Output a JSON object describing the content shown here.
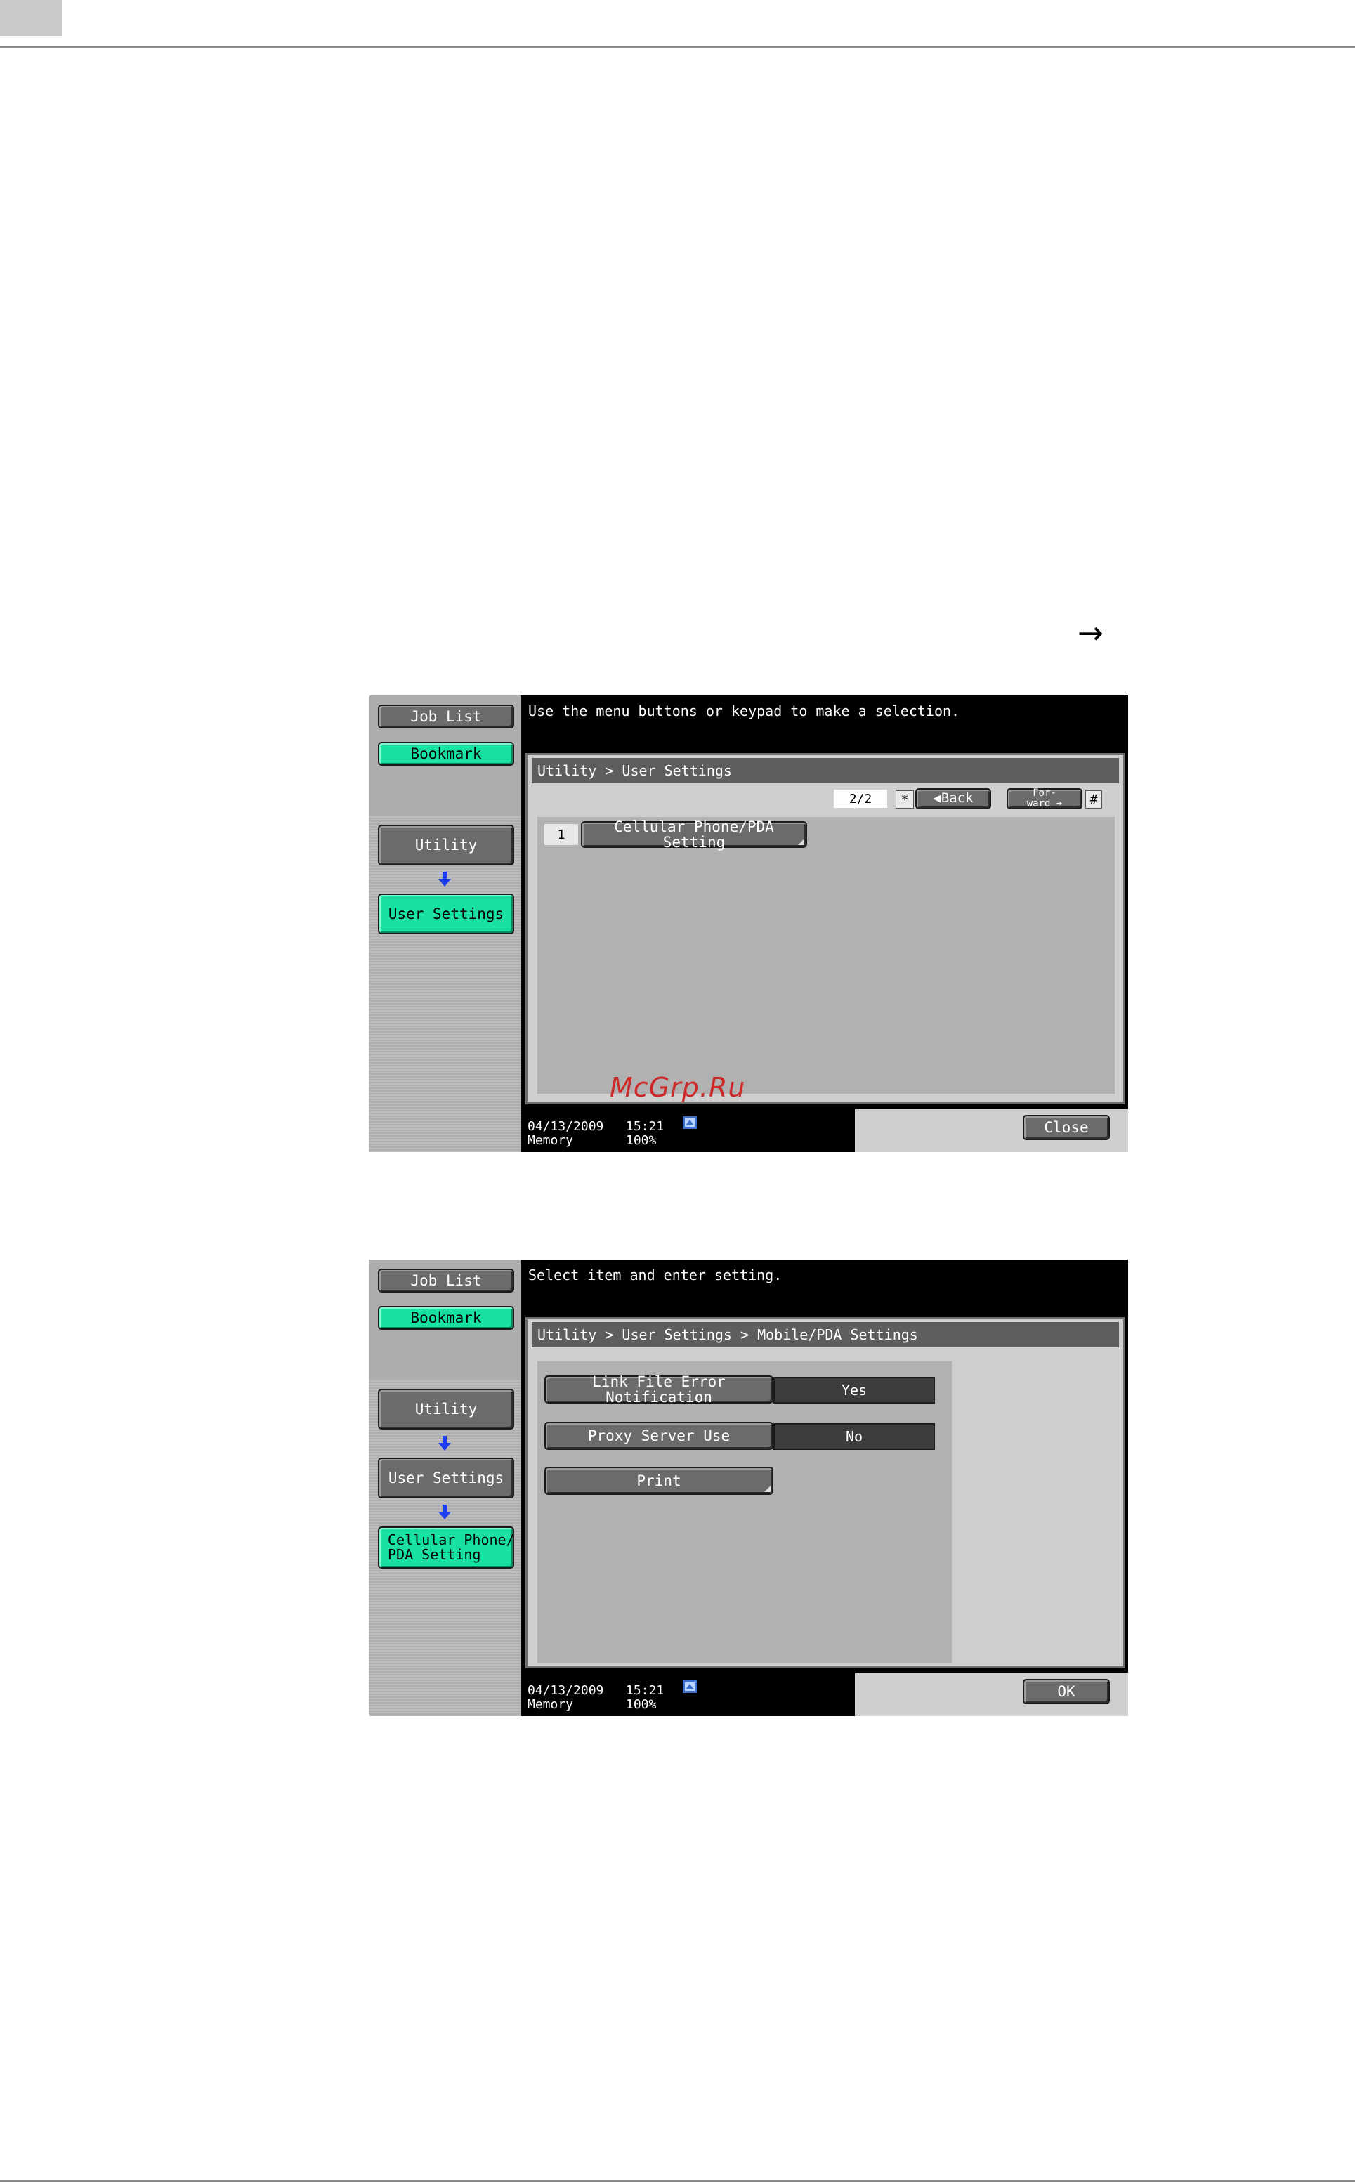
{
  "page": {
    "arrow_glyph": "→",
    "watermark": "McGrp.Ru"
  },
  "panels": [
    {
      "sidebar": {
        "job_list": "Job List",
        "bookmark": "Bookmark",
        "utility": "Utility",
        "user_settings": "User Settings"
      },
      "message": "Use the menu buttons or keypad to make a selection.",
      "breadcrumb": "Utility > User Settings",
      "page_indicator": "2/2",
      "star_key": "*",
      "back_label": "◀Back",
      "forward_label": "For-\nward ➔",
      "hash_key": "#",
      "items": [
        {
          "number": "1",
          "label": "Cellular Phone/PDA Setting"
        }
      ],
      "footer": {
        "date": "04/13/2009",
        "time": "15:21",
        "memory_label": "Memory",
        "memory_value": "100%"
      },
      "close_label": "Close"
    },
    {
      "sidebar": {
        "job_list": "Job List",
        "bookmark": "Bookmark",
        "utility": "Utility",
        "user_settings": "User Settings",
        "cellular": "Cellular Phone/\nPDA Setting"
      },
      "message": "Select item and enter setting.",
      "breadcrumb": "Utility > User Settings > Mobile/PDA Settings",
      "settings": [
        {
          "label": "Link File Error Notification",
          "value": "Yes"
        },
        {
          "label": "Proxy Server Use",
          "value": "No"
        },
        {
          "label": "Print",
          "value": ""
        }
      ],
      "footer": {
        "date": "04/13/2009",
        "time": "15:21",
        "memory_label": "Memory",
        "memory_value": "100%"
      },
      "ok_label": "OK"
    }
  ],
  "colors": {
    "accent_green": "#19e0a3",
    "button_gray": "#6b6b6b",
    "panel_black": "#000000"
  }
}
